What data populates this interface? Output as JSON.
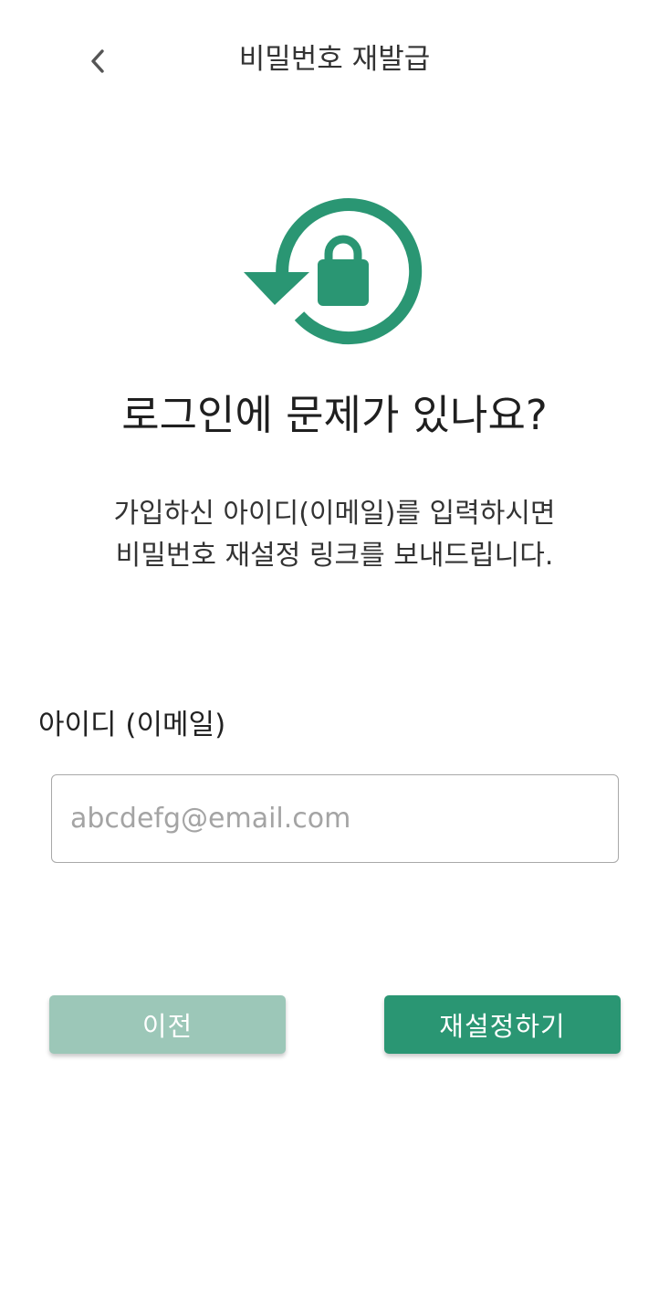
{
  "header": {
    "title": "비밀번호 재발급"
  },
  "hero": {
    "icon": "lock-reset-icon",
    "color": "#2a9673"
  },
  "main": {
    "headline": "로그인에 문제가 있나요?",
    "description_line1": "가입하신 아이디(이메일)를 입력하시면",
    "description_line2": "비밀번호 재설정 링크를 보내드립니다."
  },
  "form": {
    "email_label": "아이디 (이메일)",
    "email_value": "",
    "email_placeholder": "abcdefg@email.com"
  },
  "actions": {
    "prev_label": "이전",
    "reset_label": "재설정하기",
    "prev_color": "#9cc7b8",
    "reset_color": "#2a9673"
  }
}
